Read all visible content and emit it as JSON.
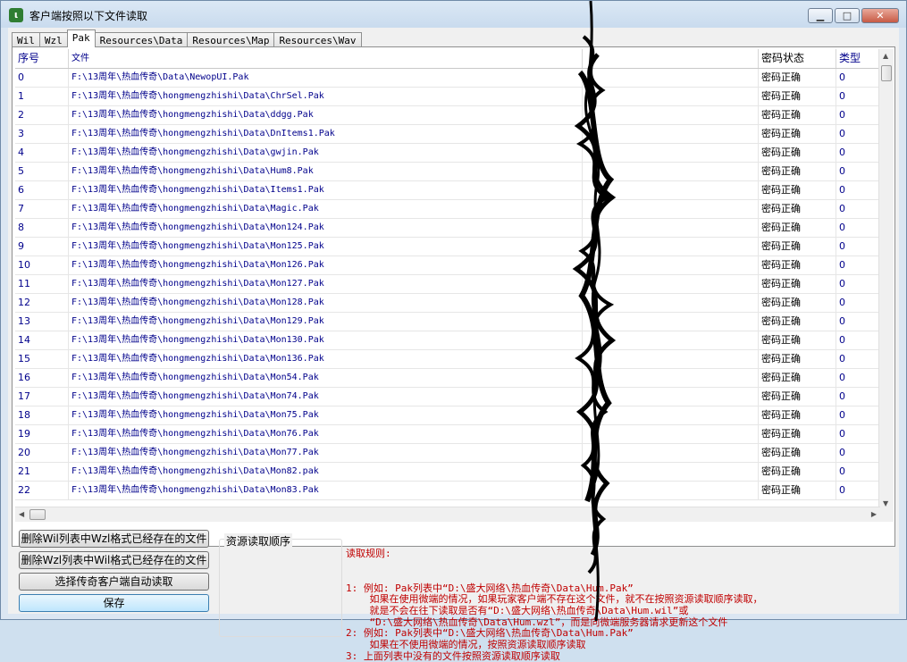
{
  "window": {
    "title": "客户端按照以下文件读取"
  },
  "tabs": [
    "Wil",
    "Wzl",
    "Pak",
    "Resources\\Data",
    "Resources\\Map",
    "Resources\\Wav"
  ],
  "active_tab": "Pak",
  "columns": {
    "index": "序号",
    "file": "文件",
    "size": "",
    "pwd_status": "密码状态",
    "type": "类型"
  },
  "rows": [
    {
      "index": "0",
      "file": "F:\\13周年\\热血传奇\\Data\\NewopUI.Pak",
      "pwd": "密码正确",
      "type": "0"
    },
    {
      "index": "1",
      "file": "F:\\13周年\\热血传奇\\hongmengzhishi\\Data\\ChrSel.Pak",
      "pwd": "密码正确",
      "type": "0"
    },
    {
      "index": "2",
      "file": "F:\\13周年\\热血传奇\\hongmengzhishi\\Data\\ddgg.Pak",
      "pwd": "密码正确",
      "type": "0"
    },
    {
      "index": "3",
      "file": "F:\\13周年\\热血传奇\\hongmengzhishi\\Data\\DnItems1.Pak",
      "pwd": "密码正确",
      "type": "0"
    },
    {
      "index": "4",
      "file": "F:\\13周年\\热血传奇\\hongmengzhishi\\Data\\gwjin.Pak",
      "pwd": "密码正确",
      "type": "0"
    },
    {
      "index": "5",
      "file": "F:\\13周年\\热血传奇\\hongmengzhishi\\Data\\Hum8.Pak",
      "pwd": "密码正确",
      "type": "0"
    },
    {
      "index": "6",
      "file": "F:\\13周年\\热血传奇\\hongmengzhishi\\Data\\Items1.Pak",
      "pwd": "密码正确",
      "type": "0"
    },
    {
      "index": "7",
      "file": "F:\\13周年\\热血传奇\\hongmengzhishi\\Data\\Magic.Pak",
      "pwd": "密码正确",
      "type": "0"
    },
    {
      "index": "8",
      "file": "F:\\13周年\\热血传奇\\hongmengzhishi\\Data\\Mon124.Pak",
      "pwd": "密码正确",
      "type": "0"
    },
    {
      "index": "9",
      "file": "F:\\13周年\\热血传奇\\hongmengzhishi\\Data\\Mon125.Pak",
      "pwd": "密码正确",
      "type": "0"
    },
    {
      "index": "10",
      "file": "F:\\13周年\\热血传奇\\hongmengzhishi\\Data\\Mon126.Pak",
      "pwd": "密码正确",
      "type": "0"
    },
    {
      "index": "11",
      "file": "F:\\13周年\\热血传奇\\hongmengzhishi\\Data\\Mon127.Pak",
      "pwd": "密码正确",
      "type": "0"
    },
    {
      "index": "12",
      "file": "F:\\13周年\\热血传奇\\hongmengzhishi\\Data\\Mon128.Pak",
      "pwd": "密码正确",
      "type": "0"
    },
    {
      "index": "13",
      "file": "F:\\13周年\\热血传奇\\hongmengzhishi\\Data\\Mon129.Pak",
      "pwd": "密码正确",
      "type": "0"
    },
    {
      "index": "14",
      "file": "F:\\13周年\\热血传奇\\hongmengzhishi\\Data\\Mon130.Pak",
      "pwd": "密码正确",
      "type": "0"
    },
    {
      "index": "15",
      "file": "F:\\13周年\\热血传奇\\hongmengzhishi\\Data\\Mon136.Pak",
      "pwd": "密码正确",
      "type": "0"
    },
    {
      "index": "16",
      "file": "F:\\13周年\\热血传奇\\hongmengzhishi\\Data\\Mon54.Pak",
      "pwd": "密码正确",
      "type": "0"
    },
    {
      "index": "17",
      "file": "F:\\13周年\\热血传奇\\hongmengzhishi\\Data\\Mon74.Pak",
      "pwd": "密码正确",
      "type": "0"
    },
    {
      "index": "18",
      "file": "F:\\13周年\\热血传奇\\hongmengzhishi\\Data\\Mon75.Pak",
      "pwd": "密码正确",
      "type": "0"
    },
    {
      "index": "19",
      "file": "F:\\13周年\\热血传奇\\hongmengzhishi\\Data\\Mon76.Pak",
      "pwd": "密码正确",
      "type": "0"
    },
    {
      "index": "20",
      "file": "F:\\13周年\\热血传奇\\hongmengzhishi\\Data\\Mon77.Pak",
      "pwd": "密码正确",
      "type": "0"
    },
    {
      "index": "21",
      "file": "F:\\13周年\\热血传奇\\hongmengzhishi\\Data\\Mon82.pak",
      "pwd": "密码正确",
      "type": "0"
    },
    {
      "index": "22",
      "file": "F:\\13周年\\热血传奇\\hongmengzhishi\\Data\\Mon83.Pak",
      "pwd": "密码正确",
      "type": "0"
    }
  ],
  "buttons": {
    "delete_wil": "删除Wil列表中Wzl格式已经存在的文件",
    "delete_wzl": "删除Wzl列表中Wil格式已经存在的文件",
    "select_client": "选择传奇客户端自动读取",
    "save": "保存"
  },
  "resource_order_label": "资源读取顺序",
  "rules": {
    "heading": "读取规则:",
    "lines": [
      "1: 例如: Pak列表中“D:\\盛大网络\\热血传奇\\Data\\Hum.Pak”",
      "    如果在使用微端的情况，如果玩家客户端不存在这个文件，就不在按照资源读取顺序读取，",
      "    就是不会在往下读取是否有“D:\\盛大网络\\热血传奇\\Data\\Hum.wil”或",
      "    “D:\\盛大网络\\热血传奇\\Data\\Hum.wzl”，而是向微端服务器请求更新这个文件",
      "2: 例如: Pak列表中“D:\\盛大网络\\热血传奇\\Data\\Hum.Pak”",
      "    如果在不使用微端的情况，按照资源读取顺序读取",
      "3: 上面列表中没有的文件按照资源读取顺序读取"
    ]
  },
  "colors": {
    "rules_text": "#c00000",
    "link_text": "#00008b"
  }
}
